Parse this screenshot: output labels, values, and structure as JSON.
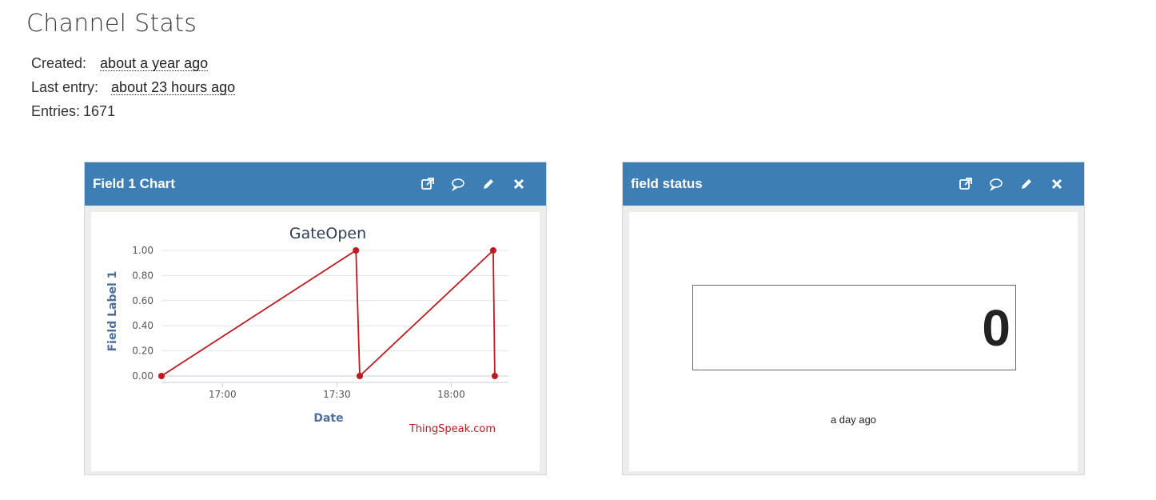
{
  "page": {
    "title": "Channel Stats"
  },
  "stats": {
    "created_label": "Created:",
    "created_value": "about a year ago",
    "last_entry_label": "Last entry:",
    "last_entry_value": "about 23 hours ago",
    "entries_label": "Entries:",
    "entries_value": "1671"
  },
  "colors": {
    "header": "#3d7fb4",
    "series": "#c0191f",
    "axis_title": "#4f6f99",
    "credit": "#c0191f"
  },
  "widgets": [
    {
      "title": "Field 1 Chart",
      "tools": [
        "external-link-icon",
        "comment-icon",
        "pencil-icon",
        "close-icon"
      ],
      "credit": "ThingSpeak.com"
    },
    {
      "title": "field status",
      "tools": [
        "external-link-icon",
        "comment-icon",
        "pencil-icon",
        "close-icon"
      ],
      "value": "0",
      "time": "a day ago"
    }
  ],
  "chart_data": {
    "type": "line",
    "title": "GateOpen",
    "xlabel": "Date",
    "ylabel": "Field Label 1",
    "x_ticks": [
      "17:00",
      "17:30",
      "18:00"
    ],
    "y_ticks": [
      "0.00",
      "0.20",
      "0.40",
      "0.60",
      "0.80",
      "1.00"
    ],
    "ylim": [
      0,
      1
    ],
    "xlim": [
      "16:44",
      "18:15"
    ],
    "grid": true,
    "legend": "none",
    "series": [
      {
        "x": [
          "16:44",
          "17:35",
          "17:36",
          "18:11",
          "18:11"
        ],
        "values": [
          0,
          1,
          0,
          1,
          0
        ]
      }
    ]
  }
}
